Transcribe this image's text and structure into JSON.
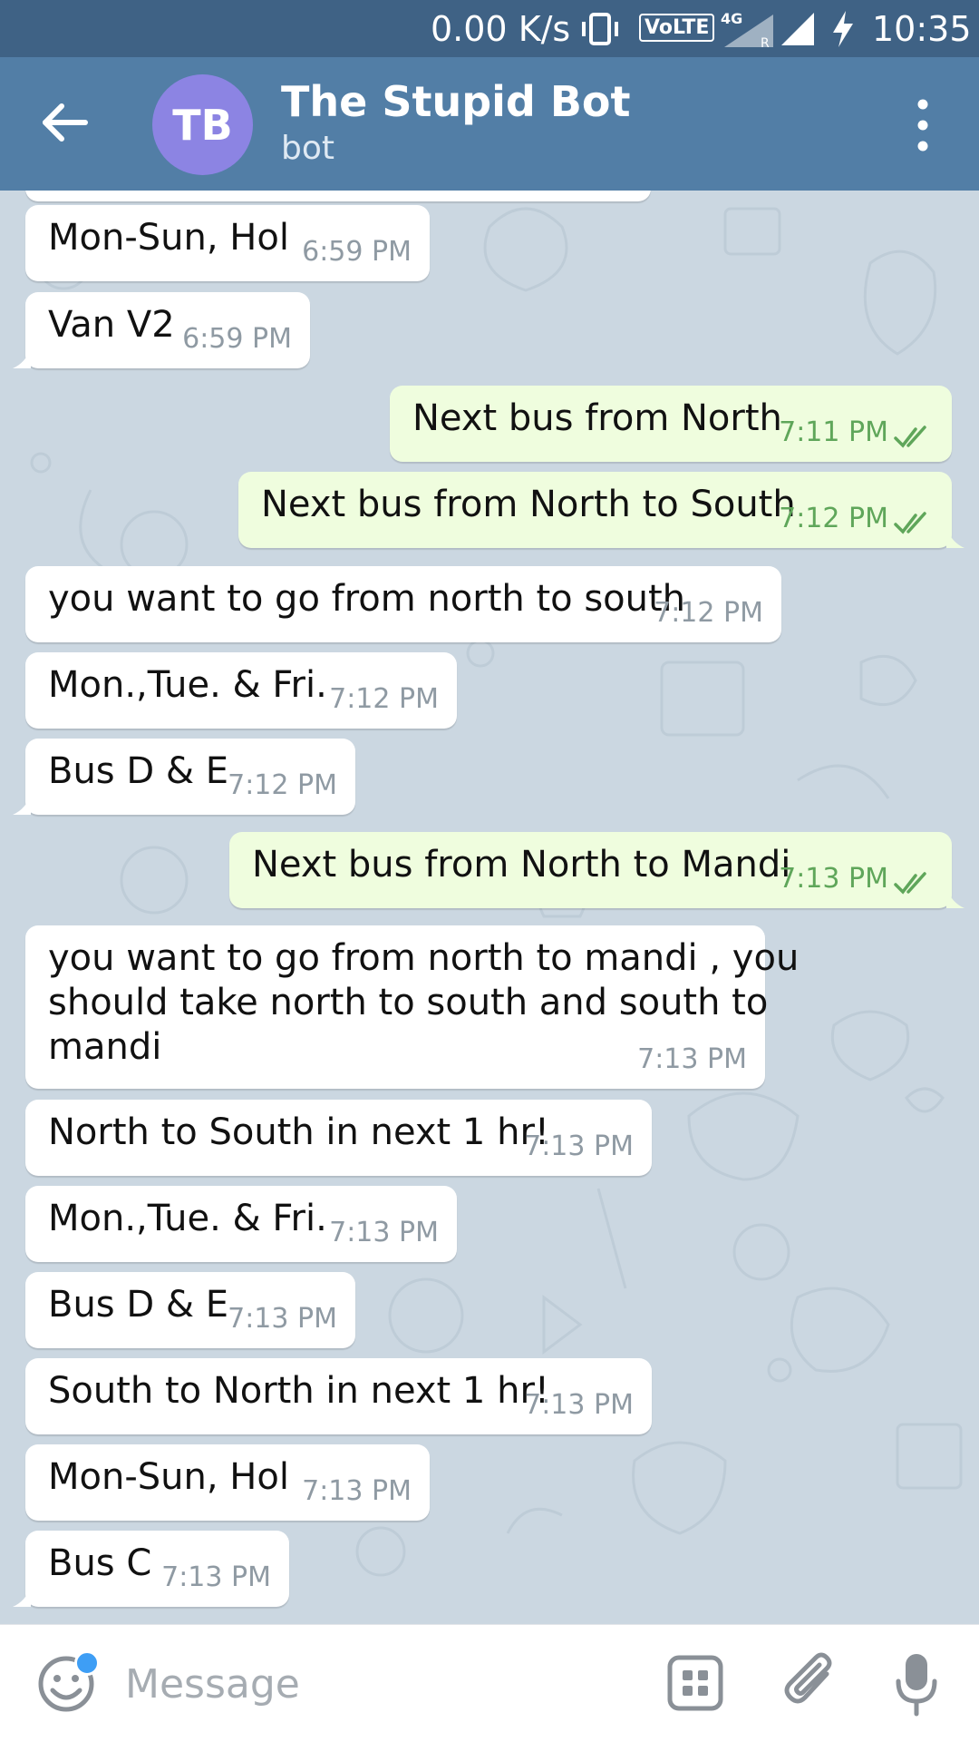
{
  "status_bar": {
    "speed": "0.00 K/s",
    "volte": "VoLTE",
    "network": "4G",
    "roaming": "R",
    "time": "10:35"
  },
  "header": {
    "avatar_initials": "TB",
    "title": "The Stupid Bot",
    "subtitle": "bot"
  },
  "messages": [
    {
      "dir": "in",
      "text": "Mon-Sun, Hol",
      "time": "6:59 PM"
    },
    {
      "dir": "in",
      "text": "Van V2",
      "time": "6:59 PM"
    },
    {
      "dir": "out",
      "text": "Next bus from North",
      "time": "7:11 PM"
    },
    {
      "dir": "out",
      "text": "Next bus from North to South",
      "time": "7:12 PM"
    },
    {
      "dir": "in",
      "text": "you want to go from north to south",
      "time": "7:12 PM"
    },
    {
      "dir": "in",
      "text": "Mon.,Tue. & Fri.",
      "time": "7:12 PM"
    },
    {
      "dir": "in",
      "text": "Bus D & E",
      "time": "7:12 PM"
    },
    {
      "dir": "out",
      "text": "Next bus from North to Mandi",
      "time": "7:13 PM"
    },
    {
      "dir": "in",
      "lines": [
        "you want to go from north to mandi , you",
        "should take north to south and south to",
        "mandi"
      ],
      "time": "7:13 PM"
    },
    {
      "dir": "in",
      "text": "North to South in next 1 hr!",
      "time": "7:13 PM"
    },
    {
      "dir": "in",
      "text": "Mon.,Tue. & Fri.",
      "time": "7:13 PM"
    },
    {
      "dir": "in",
      "text": "Bus D & E",
      "time": "7:13 PM"
    },
    {
      "dir": "in",
      "text": "South to North in next 1 hr!",
      "time": "7:13 PM"
    },
    {
      "dir": "in",
      "text": "Mon-Sun, Hol",
      "time": "7:13 PM"
    },
    {
      "dir": "in",
      "text": "Bus C",
      "time": "7:13 PM"
    }
  ],
  "input": {
    "placeholder": "Message"
  },
  "icons": {
    "back": "back-arrow-icon",
    "more": "more-vertical-icon",
    "emoji": "emoji-icon",
    "bots": "bot-commands-icon",
    "attach": "paperclip-icon",
    "mic": "microphone-icon",
    "read": "double-check-icon"
  },
  "colors": {
    "header": "#527ea6",
    "status_bar": "#3f6285",
    "incoming_bubble": "#ffffff",
    "outgoing_bubble": "#effdde",
    "outgoing_time": "#5fa65a",
    "avatar": "#8c84e3"
  }
}
